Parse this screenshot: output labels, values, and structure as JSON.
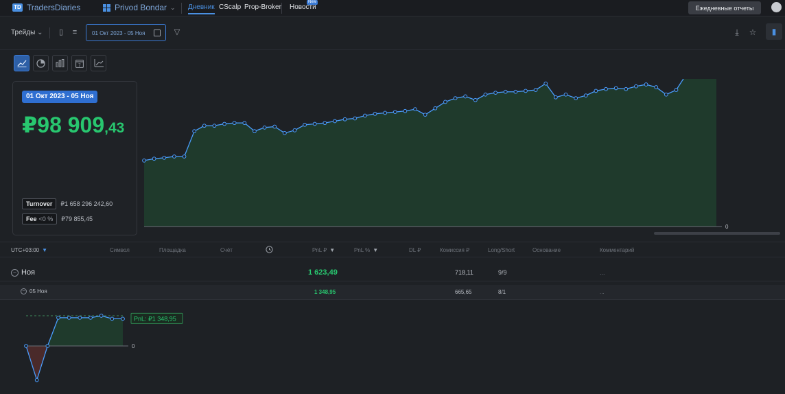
{
  "brand": {
    "name": "TradersDiaries",
    "logo_text": "TD"
  },
  "account": {
    "name": "Privod Bondar"
  },
  "nav": {
    "items": [
      {
        "label": "Дневник",
        "active": true
      },
      {
        "label": "CScalp",
        "active": false
      },
      {
        "label": "Prop-Broker",
        "active": false
      },
      {
        "label": "Новости",
        "active": false
      }
    ],
    "news_badge": "New"
  },
  "header": {
    "daily_reports": "Ежедневные отчеты"
  },
  "toolbar": {
    "trades_label": "Трейды",
    "date_range": "01 Окт 2023 - 05 Ноя",
    "icons": [
      "columns-icon",
      "align-icon",
      "calendar-icon",
      "filter-icon",
      "download-icon",
      "star-icon",
      "bar-chart-icon"
    ]
  },
  "view_tabs": [
    {
      "icon": "line-chart-icon",
      "active": true
    },
    {
      "icon": "pie-chart-icon",
      "active": false
    },
    {
      "icon": "bar-chart-icon",
      "active": false
    },
    {
      "icon": "calendar-icon",
      "active": false
    },
    {
      "icon": "trend-chart-icon",
      "active": false
    }
  ],
  "summary": {
    "period": "01 Окт 2023 - 05 Ноя",
    "pnl_main": "₽98 909",
    "pnl_cents": ",43",
    "turnover_label": "Turnover",
    "turnover_value": "₽1 658 296 242,60",
    "fee_label": "Fee",
    "fee_sub": "<0 %",
    "fee_value": "₽79 855,45"
  },
  "colors": {
    "profit": "#28c76f",
    "line": "#4a9eff",
    "fill_profit": "#1f3a2c",
    "fill_loss": "#4a2a2a"
  },
  "chart_data": [
    {
      "type": "area",
      "x": [
        1,
        2,
        3,
        4,
        5,
        6,
        7,
        8,
        9,
        10,
        11,
        12,
        13,
        14,
        15,
        16,
        17,
        18,
        19,
        20,
        21,
        22,
        23,
        24,
        25,
        26,
        27,
        28,
        29,
        30,
        31,
        32,
        33,
        34,
        35,
        36,
        37,
        38,
        39,
        40,
        41,
        42,
        43,
        44,
        45,
        46,
        47,
        48,
        49,
        50,
        51,
        52,
        53,
        54,
        55,
        56
      ],
      "values": [
        36000,
        37000,
        37500,
        38200,
        38200,
        52000,
        55000,
        55000,
        56000,
        56500,
        56500,
        52000,
        54000,
        54500,
        51000,
        52500,
        55500,
        56000,
        56500,
        57500,
        58500,
        59000,
        60500,
        61500,
        62000,
        62500,
        63000,
        64000,
        61000,
        64500,
        68000,
        70000,
        71000,
        69000,
        72000,
        73000,
        73500,
        73500,
        74000,
        74500,
        78000,
        70500,
        72000,
        70000,
        71500,
        74000,
        75000,
        75500,
        75000,
        76500,
        77500,
        76000,
        72000,
        74500,
        83000,
        84000,
        85000,
        86000
      ],
      "ylabel": "",
      "baseline_label": "0",
      "last_label": "PnL: ₽98 909,43",
      "ylim": [
        0,
        100000
      ]
    },
    {
      "type": "area",
      "values": [
        0,
        -1623,
        0,
        1400,
        1400,
        1400,
        1400,
        1500,
        1349,
        1349
      ],
      "baseline_label": "0",
      "last_label": "PnL: ₽1 348,95",
      "ylim": [
        -1700,
        1600
      ]
    }
  ],
  "table": {
    "timezone": "UTC+03:00",
    "columns": [
      "Символ",
      "Площадка",
      "Счёт",
      "PnL ₽",
      "PnL %",
      "DL ₽",
      "Комиссия ₽",
      "Long/Short",
      "Основание",
      "Комментарий"
    ],
    "group": {
      "label": "Ноя",
      "pnl": "1 623,49",
      "commission": "718,11",
      "long_short": "9/9",
      "comment": "..."
    },
    "row": {
      "label": "05 Ноя",
      "pnl": "1 348,95",
      "commission": "665,65",
      "long_short": "8/1",
      "comment": "..."
    }
  }
}
